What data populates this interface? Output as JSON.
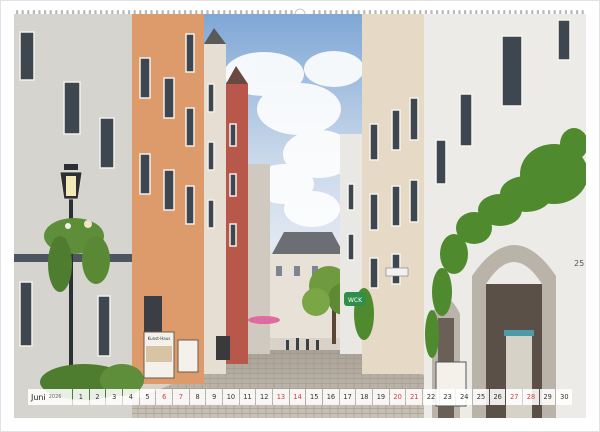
{
  "calendar": {
    "month": "Juni",
    "year": "2026",
    "days": [
      "1",
      "2",
      "3",
      "4",
      "5",
      "6",
      "7",
      "8",
      "9",
      "10",
      "11",
      "12",
      "13",
      "14",
      "15",
      "16",
      "17",
      "18",
      "19",
      "20",
      "21",
      "22",
      "23",
      "24",
      "25",
      "26",
      "27",
      "28",
      "29",
      "30"
    ],
    "weekend_days": [
      "6",
      "7",
      "13",
      "14",
      "20",
      "21",
      "27",
      "28"
    ]
  },
  "photo": {
    "shop_sign": "Kunst-Haus",
    "green_sign": "WCK",
    "house_number": "25"
  },
  "colors": {
    "weekend": "#d0413e",
    "weekday": "#333333",
    "strip": "#ffffff",
    "sky": "#9fbfe0"
  }
}
